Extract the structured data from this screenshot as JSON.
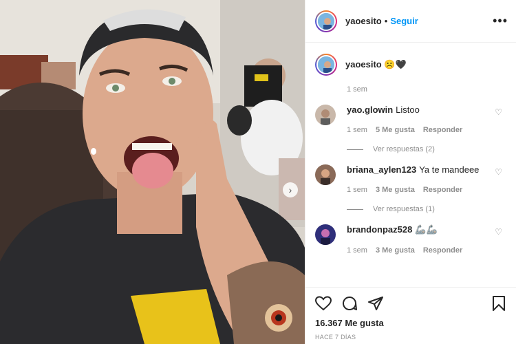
{
  "post": {
    "username": "yaoesito",
    "follow_label": "Seguir",
    "separator": "•",
    "more_label": "•••"
  },
  "caption": {
    "username": "yaoesito",
    "text": "☹️🖤",
    "time": "1 sem"
  },
  "comments": [
    {
      "username": "yao.glowin",
      "text": "Listoo",
      "time": "1 sem",
      "likes": "5 Me gusta",
      "reply": "Responder",
      "view_replies": "Ver respuestas (2)",
      "avatar_color": "#b89c8a"
    },
    {
      "username": "briana_aylen123",
      "text": "Ya te mandeee",
      "time": "1 sem",
      "likes": "3 Me gusta",
      "reply": "Responder",
      "view_replies": "Ver respuestas (1)",
      "avatar_color": "#7a5a4a"
    },
    {
      "username": "brandonpaz528",
      "text": "🦾🦾",
      "time": "1 sem",
      "likes": "3 Me gusta",
      "reply": "Responder",
      "view_replies": "",
      "avatar_color": "#3a3a8c"
    }
  ],
  "footer": {
    "likes": "16.367 Me gusta",
    "ago": "HACE 7 DÍAS"
  },
  "icons": {
    "like": "heart-icon",
    "comment": "comment-icon",
    "share": "share-icon",
    "save": "bookmark-icon",
    "next": "chevron-right-icon",
    "comment_like": "small-heart-icon"
  },
  "colors": {
    "link": "#0095f6",
    "muted": "#8e8e8e",
    "text": "#262626"
  }
}
